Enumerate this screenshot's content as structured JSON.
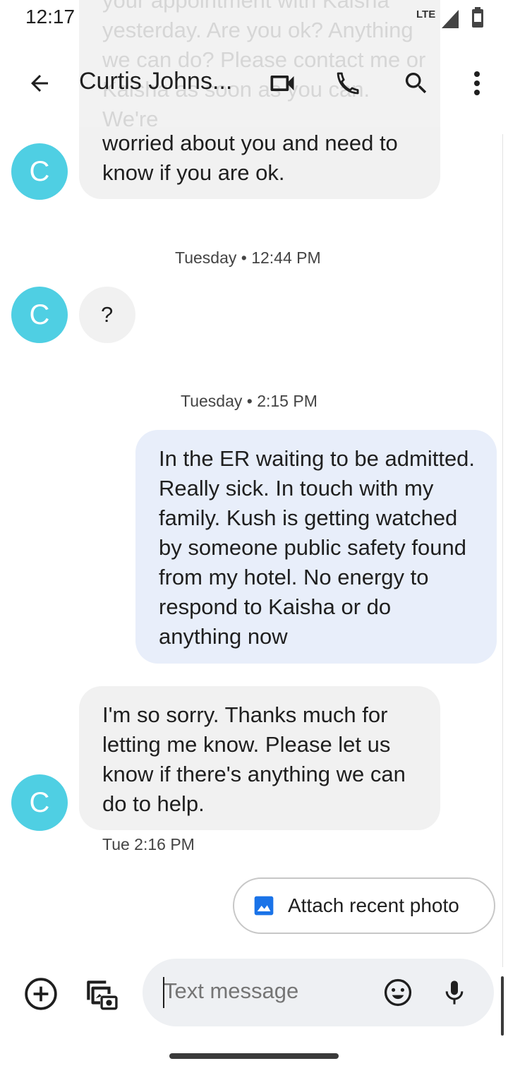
{
  "status_bar": {
    "time": "12:17",
    "network": "LTE"
  },
  "header": {
    "contact_name": "Curtis Johns..."
  },
  "conversation": {
    "ghost_text": "your appointment with Kaisha yesterday. Are you ok? Anything we can do? Please contact me or Kaisha as soon as you can. We're",
    "msg1_text": "worried about you and need to know if you are ok.",
    "stamp1": "Tuesday • 12:44 PM",
    "msg2_text": "?",
    "stamp2": "Tuesday • 2:15 PM",
    "msg3_text": "In the ER waiting to be admitted. Really sick. In touch with my family. Kush is getting watched by someone public safety found from my hotel. No energy to respond to Kaisha or do anything now",
    "msg4_text": "I'm so sorry. Thanks much for letting me know. Please let us know if there's anything we can do to help.",
    "msg4_time": "Tue 2:16 PM",
    "avatar_letter": "C"
  },
  "suggestion": {
    "label": "Attach recent photo"
  },
  "composer": {
    "placeholder": "Text message"
  },
  "colors": {
    "avatar": "#4fcfe3",
    "outgoing_bubble": "#e8eefa",
    "incoming_bubble": "#f1f1f1",
    "photo_icon": "#1a73e8"
  }
}
